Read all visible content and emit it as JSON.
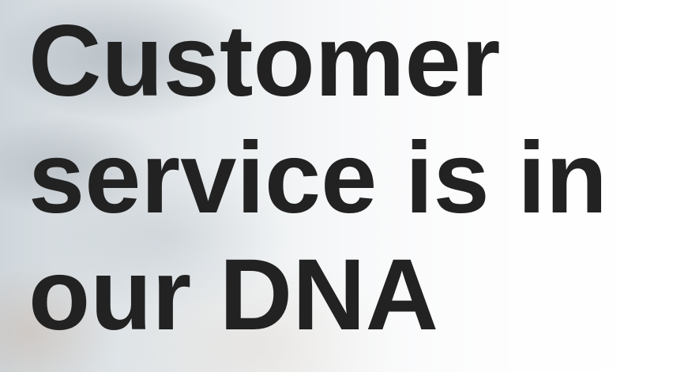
{
  "hero": {
    "headline_lines": [
      "Customer",
      "service is in",
      "our DNA"
    ],
    "text_color": "#222222",
    "background_colors": [
      "#cfd6db",
      "#ffffff"
    ]
  }
}
